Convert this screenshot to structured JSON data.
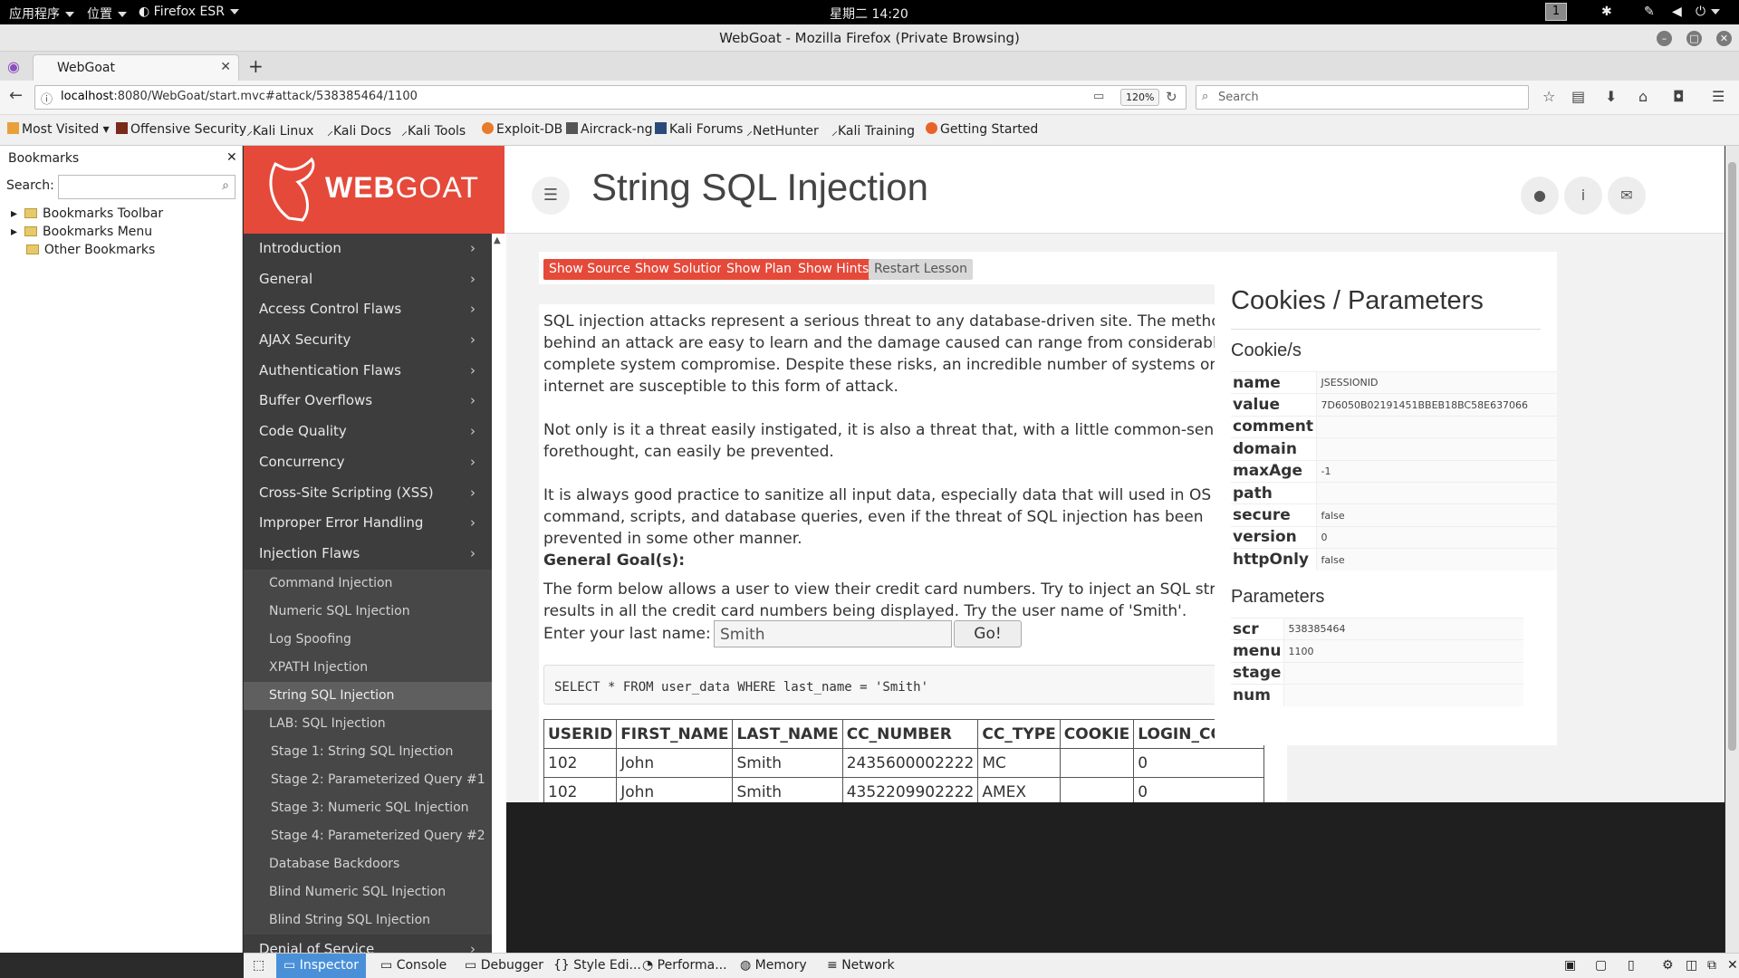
{
  "desktop": {
    "apps_menu": "应用程序",
    "places_menu": "位置",
    "active_app": "Firefox ESR",
    "clock": "星期二 14:20",
    "workspace": "1"
  },
  "window": {
    "title": "WebGoat - Mozilla Firefox (Private Browsing)"
  },
  "tabs": [
    {
      "label": "WebGoat"
    }
  ],
  "navbar": {
    "url_host": "localhost",
    "url_rest": ":8080/WebGoat/start.mvc#attack/538385464/1100",
    "zoom": "120%",
    "search_placeholder": "Search"
  },
  "bookmarks_toolbar": [
    "Most Visited",
    "Offensive Security",
    "Kali Linux",
    "Kali Docs",
    "Kali Tools",
    "Exploit-DB",
    "Aircrack-ng",
    "Kali Forums",
    "NetHunter",
    "Kali Training",
    "Getting Started"
  ],
  "bookmarks_sidebar": {
    "title": "Bookmarks",
    "search_label": "Search:",
    "items": [
      "Bookmarks Toolbar",
      "Bookmarks Menu",
      "Other Bookmarks"
    ]
  },
  "webgoat": {
    "logo_bold": "WEB",
    "logo_light": "GOAT",
    "page_title": "String SQL Injection",
    "categories_top": [
      "Introduction",
      "General",
      "Access Control Flaws",
      "AJAX Security",
      "Authentication Flaws",
      "Buffer Overflows",
      "Code Quality",
      "Concurrency",
      "Cross-Site Scripting (XSS)",
      "Improper Error Handling",
      "Injection Flaws"
    ],
    "injection_lessons": [
      "Command Injection",
      "Numeric SQL Injection",
      "Log Spoofing",
      "XPATH Injection",
      "String SQL Injection",
      "LAB: SQL Injection",
      "Stage 1: String SQL Injection",
      "Stage 2: Parameterized Query #1",
      "Stage 3: Numeric SQL Injection",
      "Stage 4: Parameterized Query #2",
      "Database Backdoors",
      "Blind Numeric SQL Injection",
      "Blind String SQL Injection"
    ],
    "categories_bottom": [
      "Denial of Service"
    ],
    "buttons": {
      "show_source": "Show Source",
      "show_solution": "Show Solution",
      "show_plan": "Show Plan",
      "show_hints": "Show Hints",
      "restart": "Restart Lesson"
    },
    "lesson": {
      "p1": "SQL injection attacks represent a serious threat to any database-driven site. The methods behind an attack are easy to learn and the damage caused can range from considerable to complete system compromise. Despite these risks, an incredible number of systems on the internet are susceptible to this form of attack.",
      "p2": "Not only is it a threat easily instigated, it is also a threat that, with a little common-sense and forethought, can easily be prevented.",
      "p3": "It is always good practice to sanitize all input data, especially data that will used in OS command, scripts, and database queries, even if the threat of SQL injection has been prevented in some other manner.",
      "goal_heading": "General Goal(s):",
      "goal_text": "The form below allows a user to view their credit card numbers. Try to inject an SQL string that results in all the credit card numbers being displayed. Try the user name of 'Smith'.",
      "input_label": "Enter your last name:",
      "input_value": "Smith",
      "go_label": "Go!",
      "query": "SELECT * FROM user_data WHERE last_name = 'Smith'"
    },
    "results": {
      "headers": [
        "USERID",
        "FIRST_NAME",
        "LAST_NAME",
        "CC_NUMBER",
        "CC_TYPE",
        "COOKIE",
        "LOGIN_COUNT"
      ],
      "rows": [
        [
          "102",
          "John",
          "Smith",
          "2435600002222",
          "MC",
          "",
          "0"
        ],
        [
          "102",
          "John",
          "Smith",
          "4352209902222",
          "AMEX",
          "",
          "0"
        ]
      ]
    },
    "cookies_panel": {
      "title": "Cookies / Parameters",
      "cookies_heading": "Cookie/s",
      "cookies": [
        [
          "name",
          "JSESSIONID"
        ],
        [
          "value",
          "7D6050B02191451BBEB18BC58E637066"
        ],
        [
          "comment",
          ""
        ],
        [
          "domain",
          ""
        ],
        [
          "maxAge",
          "-1"
        ],
        [
          "path",
          ""
        ],
        [
          "secure",
          "false"
        ],
        [
          "version",
          "0"
        ],
        [
          "httpOnly",
          "false"
        ]
      ],
      "params_heading": "Parameters",
      "params": [
        [
          "scr",
          "538385464"
        ],
        [
          "menu",
          "1100"
        ],
        [
          "stage",
          ""
        ],
        [
          "num",
          ""
        ]
      ]
    }
  },
  "devtools": {
    "tabs": [
      "Inspector",
      "Console",
      "Debugger",
      "Style Edi...",
      "Performa...",
      "Memory",
      "Network"
    ]
  }
}
